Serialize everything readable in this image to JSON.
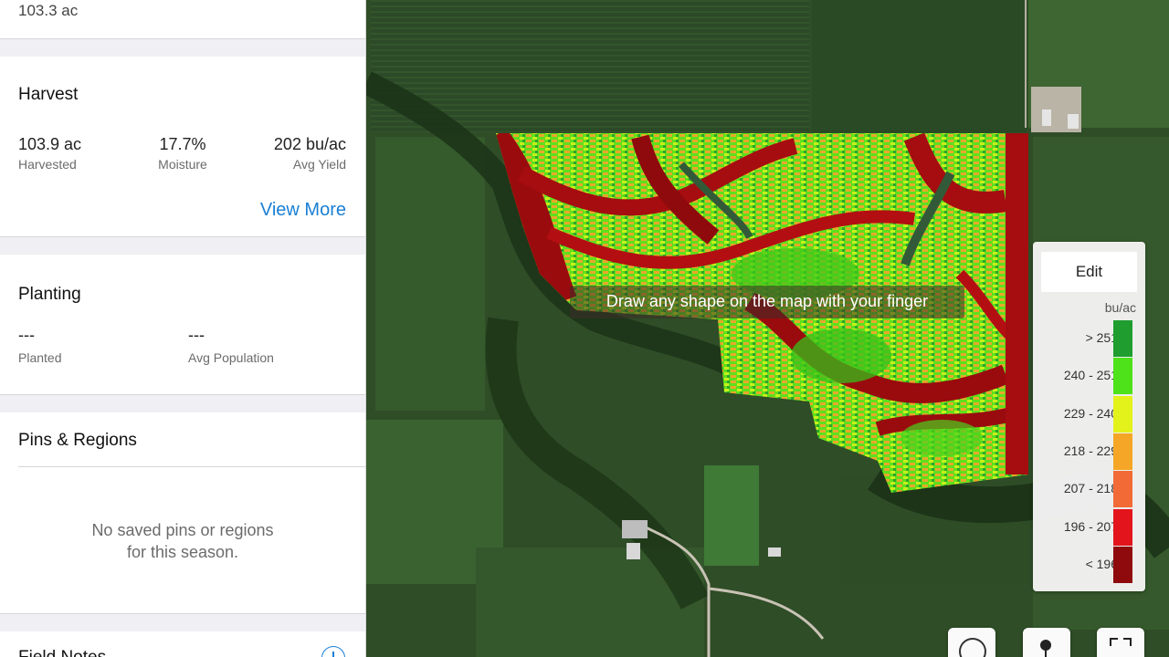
{
  "top": {
    "acres": "103.3 ac"
  },
  "harvest": {
    "title": "Harvest",
    "stats": [
      {
        "value": "103.9 ac",
        "label": "Harvested"
      },
      {
        "value": "17.7%",
        "label": "Moisture"
      },
      {
        "value": "202 bu/ac",
        "label": "Avg Yield"
      }
    ],
    "view_more": "View More"
  },
  "planting": {
    "title": "Planting",
    "stats": [
      {
        "value": "---",
        "label": "Planted"
      },
      {
        "value": "---",
        "label": "Avg Population"
      }
    ]
  },
  "pins": {
    "title": "Pins & Regions",
    "empty_line1": "No saved pins or regions",
    "empty_line2": "for this season."
  },
  "field_notes": {
    "title": "Field Notes"
  },
  "map": {
    "hint": "Draw any shape on the map with your finger",
    "legend": {
      "edit_label": "Edit",
      "unit": "bu/ac",
      "ranges": [
        {
          "label": "> 251",
          "color": "#1f9e2f"
        },
        {
          "label": "240 - 251",
          "color": "#4ee21a"
        },
        {
          "label": "229 - 240",
          "color": "#e3f21a"
        },
        {
          "label": "218 - 229",
          "color": "#f5a626"
        },
        {
          "label": "207 - 218",
          "color": "#f26a35"
        },
        {
          "label": "196 - 207",
          "color": "#e3141c"
        },
        {
          "label": "< 196",
          "color": "#8f0a0c"
        }
      ]
    },
    "tools": [
      "circle-draw-icon",
      "pin-drop-icon",
      "fullscreen-icon"
    ]
  }
}
